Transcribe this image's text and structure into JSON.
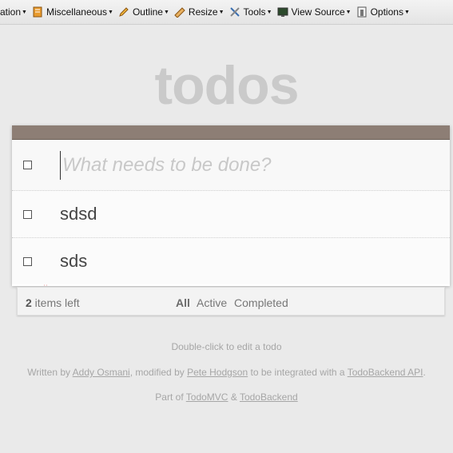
{
  "toolbar": {
    "items": [
      {
        "label": "ation",
        "icon": "none"
      },
      {
        "label": "Miscellaneous",
        "icon": "notebook-icon"
      },
      {
        "label": "Outline",
        "icon": "pencil-icon"
      },
      {
        "label": "Resize",
        "icon": "ruler-icon"
      },
      {
        "label": "Tools",
        "icon": "tools-icon"
      },
      {
        "label": "View Source",
        "icon": "monitor-icon"
      },
      {
        "label": "Options",
        "icon": "options-icon"
      }
    ]
  },
  "title": "todos",
  "new_todo": {
    "placeholder": "What needs to be done?",
    "value": ""
  },
  "todos": [
    {
      "label": "sdsd",
      "completed": false
    },
    {
      "label": "sds",
      "completed": false
    }
  ],
  "footer": {
    "count": "2",
    "count_suffix": " items left",
    "filters": [
      "All",
      "Active",
      "Completed"
    ],
    "selected_filter": "All"
  },
  "info": {
    "hint": "Double-click to edit a todo",
    "written_by": "Written by",
    "author1": "Addy Osmani",
    "modified_by": ", modified by",
    "author2": "Pete Hodgson",
    "integrated": "to be integrated with a",
    "api_link": "TodoBackend API",
    "period": ".",
    "part_of": "Part of",
    "link1": "TodoMVC",
    "amp": "&",
    "link2": "TodoBackend"
  },
  "colors": {
    "header": "#8d7e75",
    "title": "#c7c7c7",
    "background": "#eaeaea"
  }
}
